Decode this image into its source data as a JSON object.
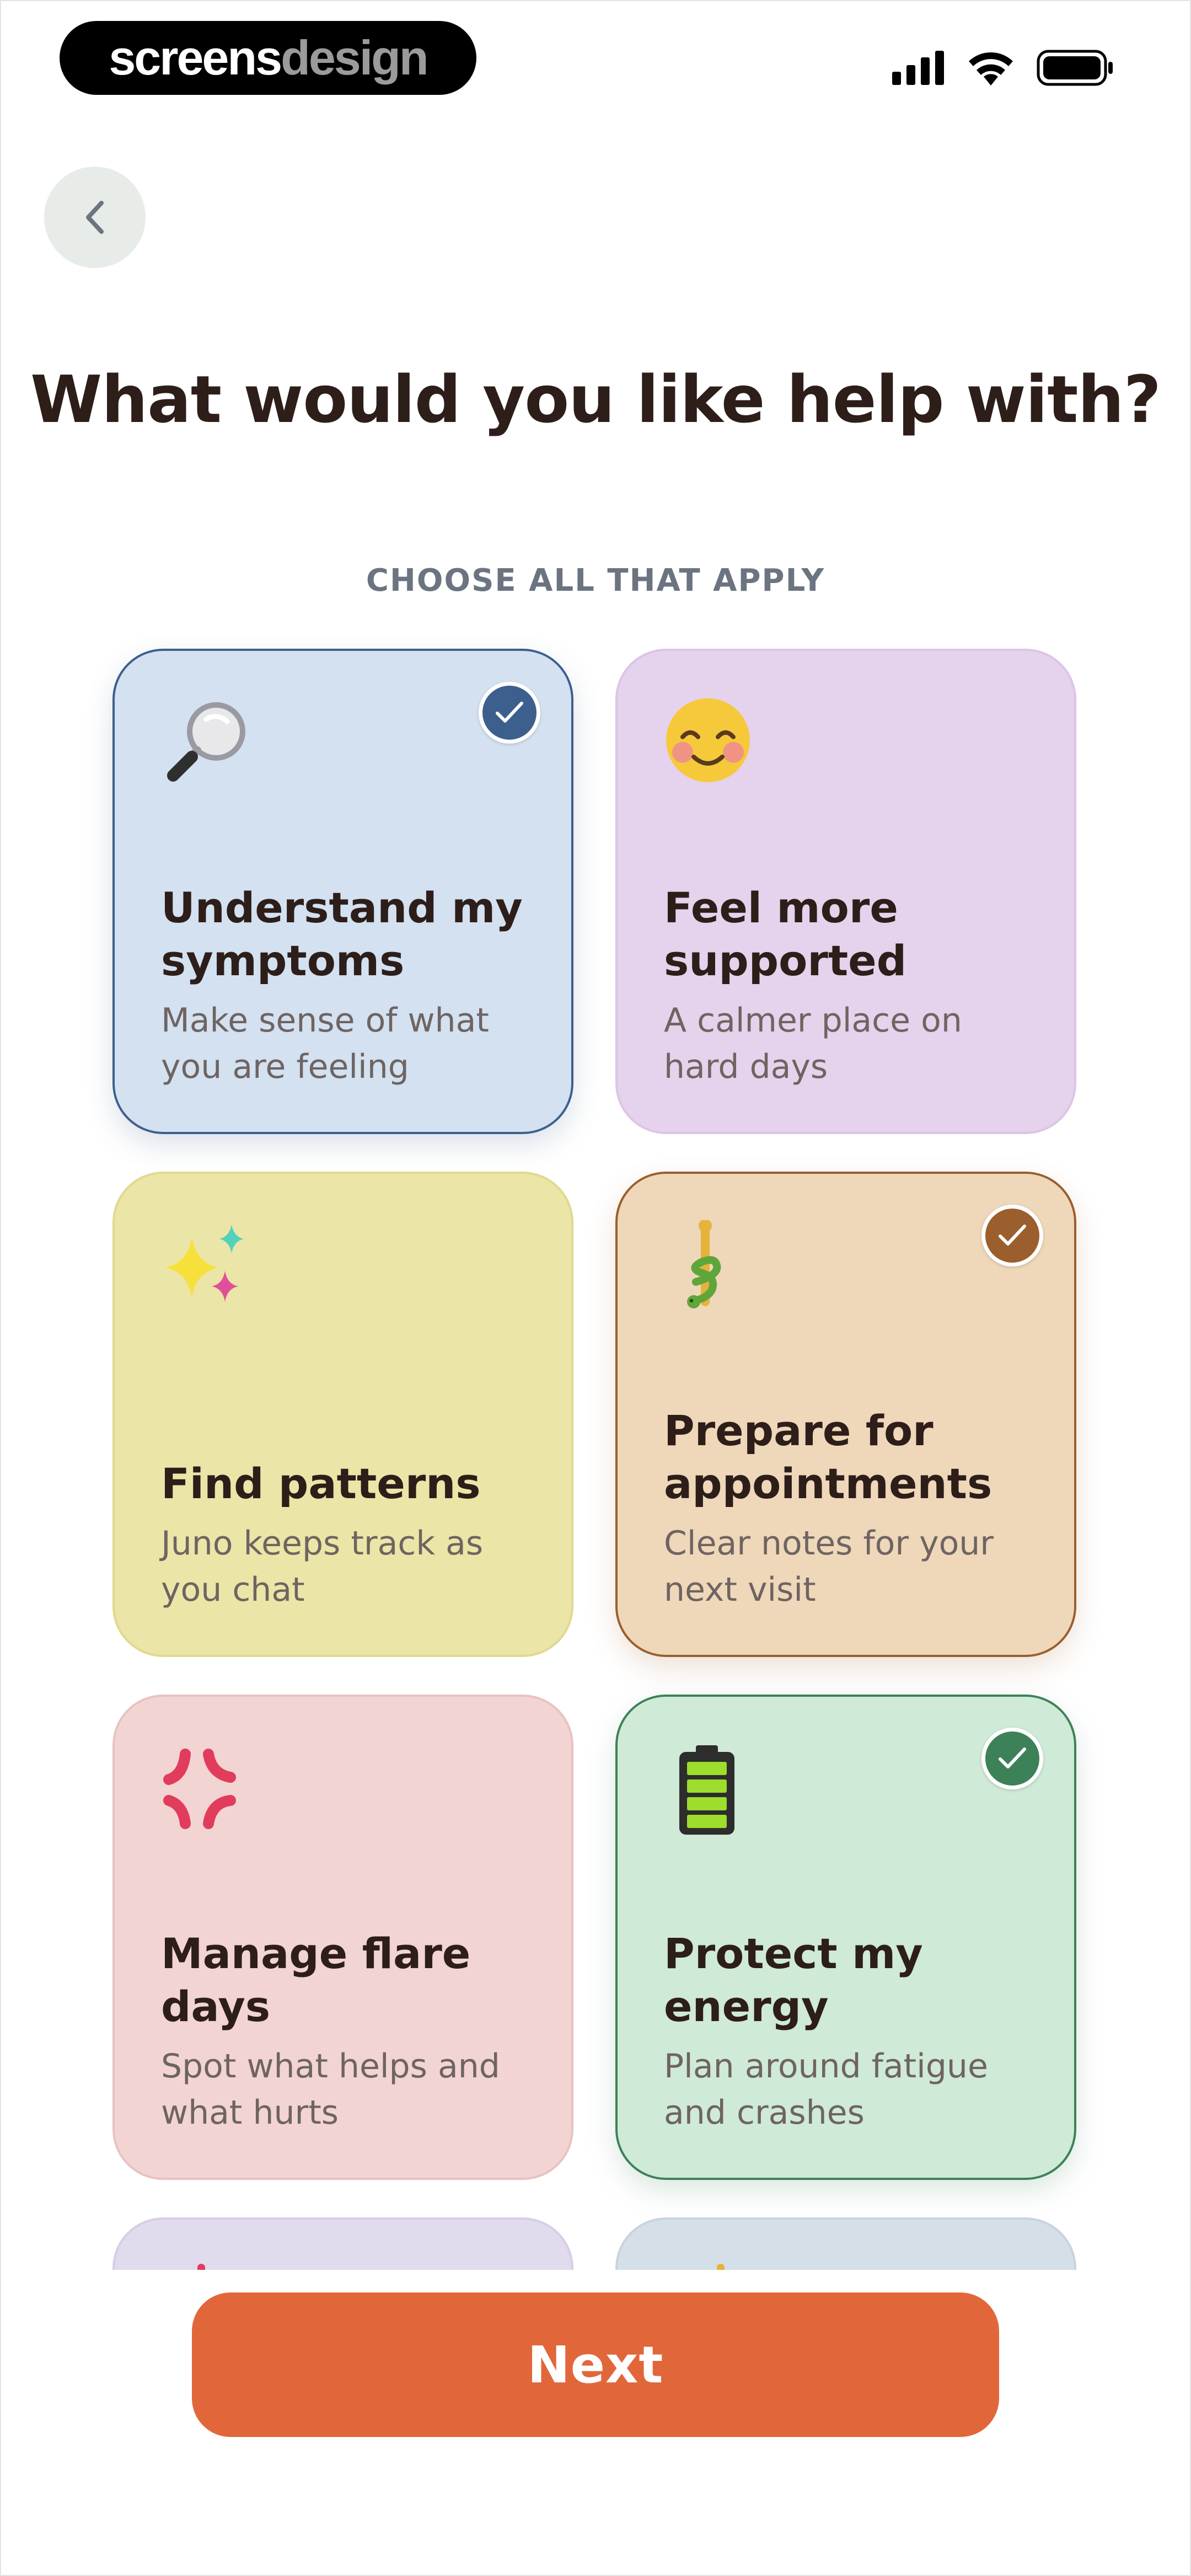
{
  "status_bar": {
    "brand_part1": "screens",
    "brand_part2": "design",
    "icons": [
      "cellular-signal-icon",
      "wifi-icon",
      "battery-icon"
    ]
  },
  "header": {
    "back_icon": "chevron-left-icon",
    "title": "What would you like help with?",
    "subtitle": "CHOOSE ALL THAT APPLY"
  },
  "options": [
    {
      "title_l1": "Understand my",
      "title_l2": "symptoms",
      "desc_l1": "Make sense of what",
      "desc_l2": "you are feeling",
      "icon": "magnifying-glass-icon",
      "selected": true,
      "accent": "#3d5f8d"
    },
    {
      "title_l1": "Feel more",
      "title_l2": "supported",
      "desc_l1": "A calmer place on",
      "desc_l2": "hard days",
      "icon": "smiling-face-icon",
      "selected": false,
      "accent": "#dcc4e6"
    },
    {
      "title_l1": "Find patterns",
      "title_l2": "",
      "desc_l1": "Juno keeps track as",
      "desc_l2": "you chat",
      "icon": "sparkles-icon",
      "selected": false,
      "accent": "#e0d98f"
    },
    {
      "title_l1": "Prepare for",
      "title_l2": "appointments",
      "desc_l1": "Clear notes for your",
      "desc_l2": "next visit",
      "icon": "medical-staff-icon",
      "selected": true,
      "accent": "#9a5f2c"
    },
    {
      "title_l1": "Manage flare",
      "title_l2": "days",
      "desc_l1": "Spot what helps and",
      "desc_l2": "what hurts",
      "icon": "anger-symbol-icon",
      "selected": false,
      "accent": "#e8c2c1"
    },
    {
      "title_l1": "Protect my",
      "title_l2": "energy",
      "desc_l1": "Plan around fatigue",
      "desc_l2": "and crashes",
      "icon": "battery-full-icon",
      "selected": true,
      "accent": "#3d8158"
    }
  ],
  "next_button": {
    "label": "Next"
  },
  "colors": {
    "primary": "#e1673b",
    "title": "#2d1e1a",
    "subtitle": "#6b7480"
  }
}
